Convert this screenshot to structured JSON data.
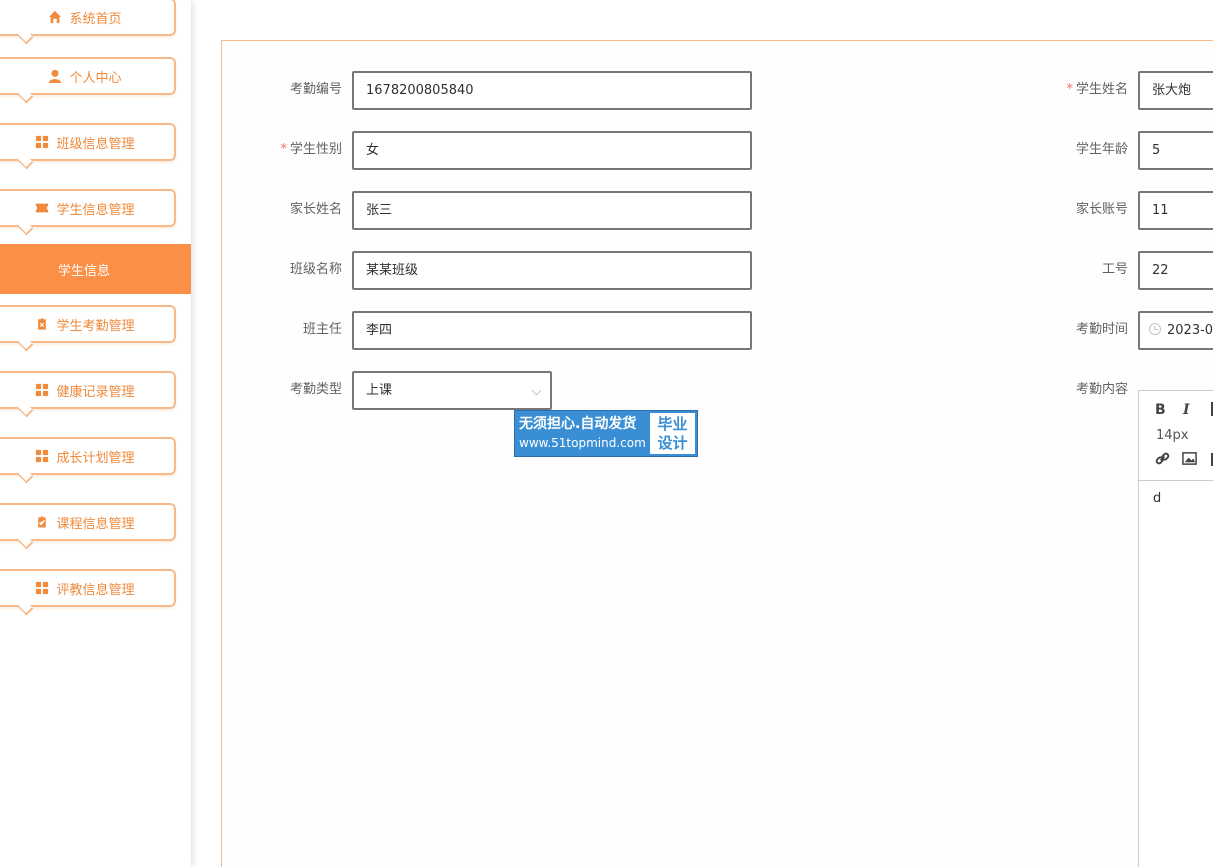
{
  "sidebar": {
    "items": [
      {
        "label": "系统首页",
        "icon": "home-icon"
      },
      {
        "label": "个人中心",
        "icon": "user-icon"
      },
      {
        "label": "班级信息管理",
        "icon": "grid-icon"
      },
      {
        "label": "学生信息管理",
        "icon": "ticket-icon"
      },
      {
        "label": "学生考勤管理",
        "icon": "clipboard-icon"
      },
      {
        "label": "健康记录管理",
        "icon": "grid-icon"
      },
      {
        "label": "成长计划管理",
        "icon": "grid-icon"
      },
      {
        "label": "课程信息管理",
        "icon": "clipboard-check-icon"
      },
      {
        "label": "评教信息管理",
        "icon": "grid-icon"
      }
    ],
    "active_submenu": "学生信息",
    "accent_color": "#fa8f45"
  },
  "form": {
    "kaoqin_bianhao": {
      "label": "考勤编号",
      "value": "1678200805840"
    },
    "xuesheng_xingbie": {
      "label": "学生性别",
      "value": "女"
    },
    "jiazhang_xingming": {
      "label": "家长姓名",
      "value": "张三"
    },
    "banji_mingcheng": {
      "label": "班级名称",
      "value": "某某班级"
    },
    "banzhuren": {
      "label": "班主任",
      "value": "李四"
    },
    "kaoqin_leixing": {
      "label": "考勤类型",
      "value": "上课"
    },
    "xuesheng_xingming": {
      "label": "学生姓名",
      "value": "张大炮"
    },
    "xuesheng_nianling": {
      "label": "学生年龄",
      "value": "5"
    },
    "jiazhang_zhanghao": {
      "label": "家长账号",
      "value": "11"
    },
    "gonghao": {
      "label": "工号",
      "value": "22"
    },
    "kaoqin_shijian": {
      "label": "考勤时间",
      "value": "2023-0"
    },
    "kaoqin_neirong": {
      "label": "考勤内容",
      "value": "d"
    },
    "required_mark": "*"
  },
  "editor": {
    "bold": "B",
    "italic": "I",
    "font_size": "14px"
  },
  "watermark": {
    "line1": "无须担心.自动发货",
    "line2": "www.51topmind.com",
    "right1": "毕业",
    "right2": "设计"
  }
}
